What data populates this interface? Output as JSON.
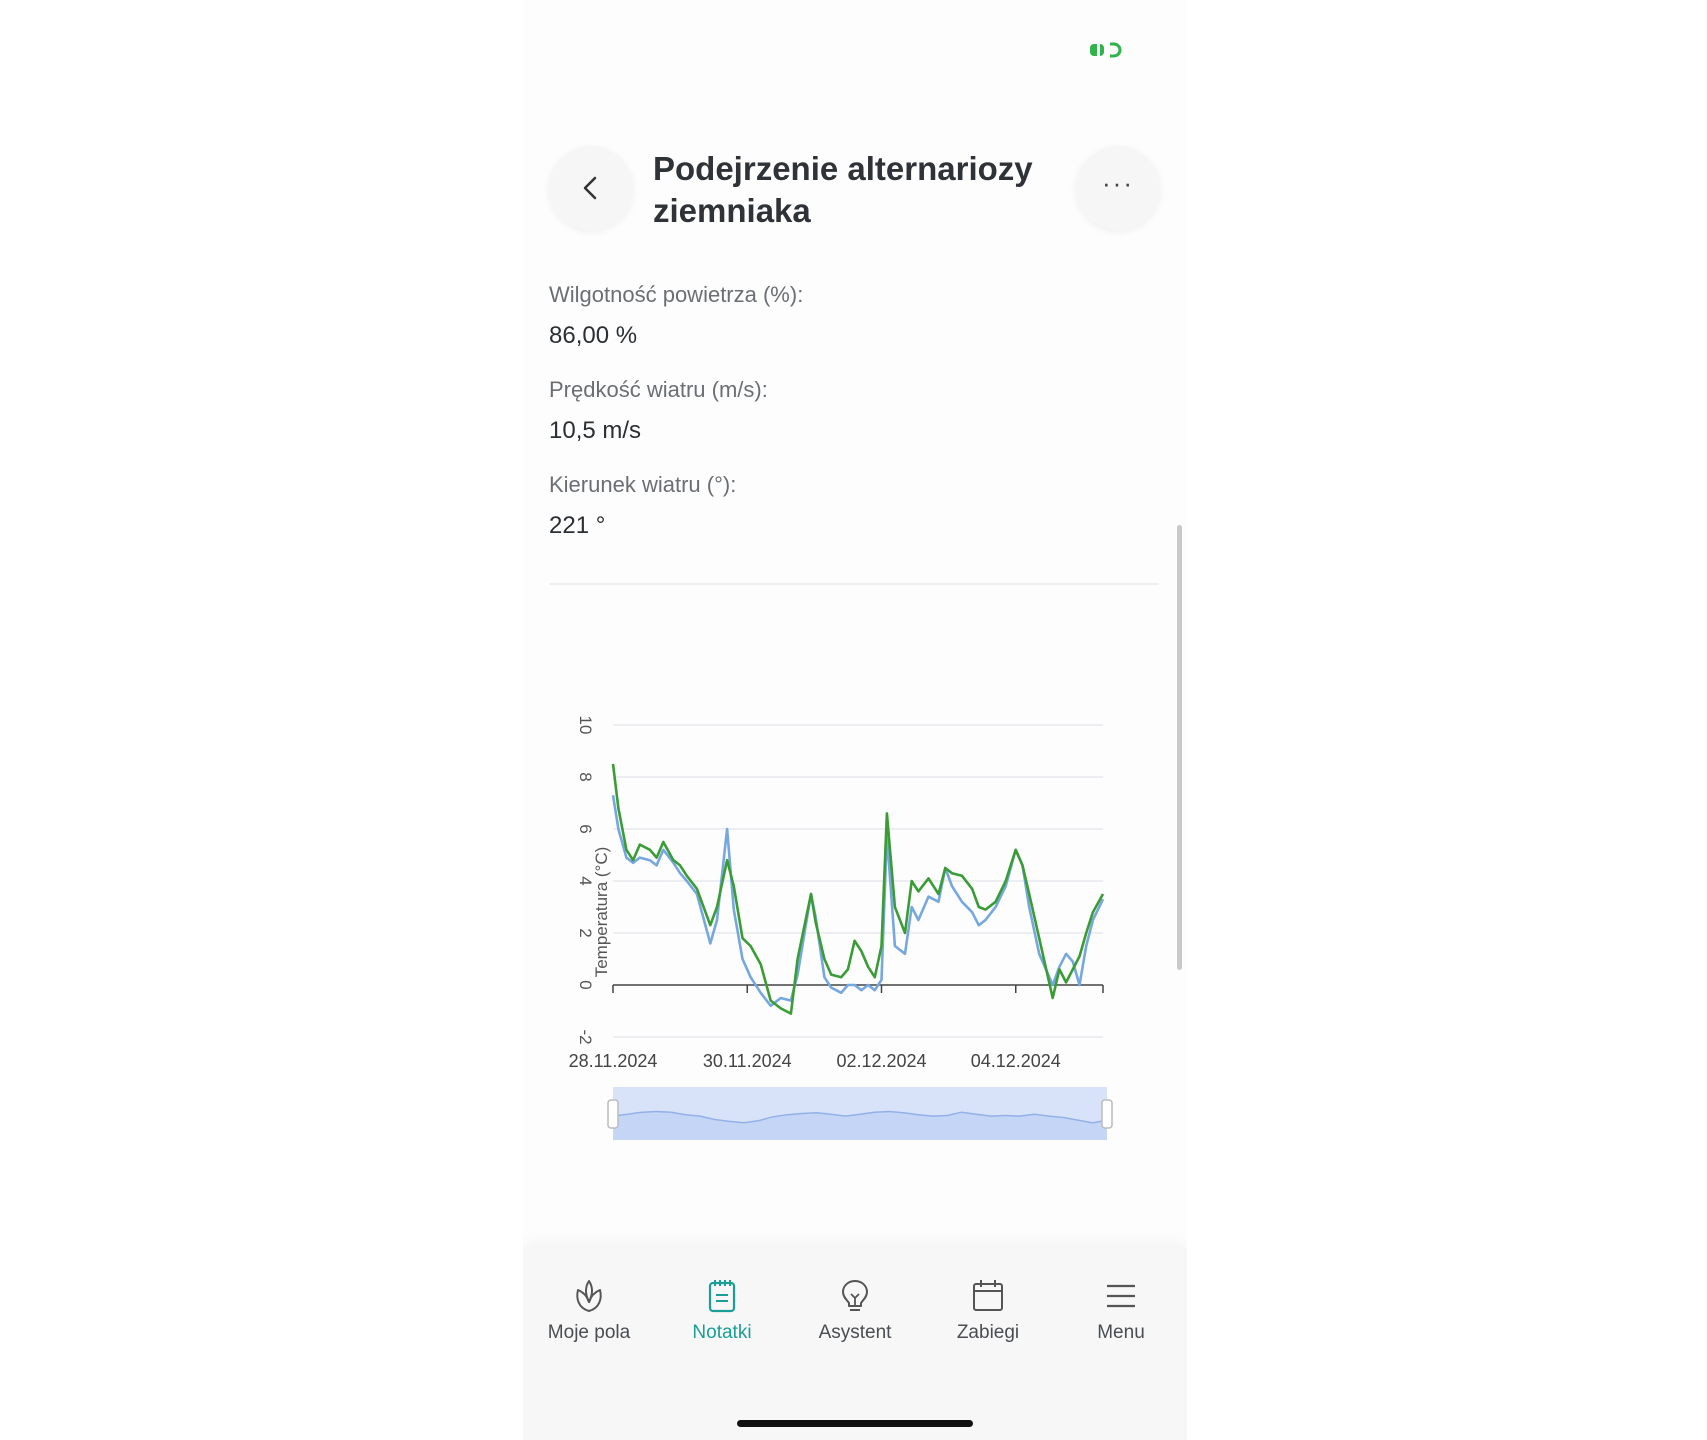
{
  "header": {
    "title": "Podejrzenie alternariozy ziemniaka",
    "back_icon": "chevron-left-icon",
    "more_icon": "more-horizontal-icon",
    "more_label": "···"
  },
  "status": {
    "indicator_icon": "battery-status-icon",
    "indicator_color": "#2fb34a"
  },
  "details": [
    {
      "label": "Wilgotność powietrza (%):",
      "value": "86,00 %"
    },
    {
      "label": "Prędkość wiatru (m/s):",
      "value": "10,5 m/s"
    },
    {
      "label": "Kierunek wiatru (°):",
      "value": "221 °"
    }
  ],
  "chart_data": {
    "type": "line",
    "title": "",
    "xlabel": "",
    "ylabel": "Temperatura (°C)",
    "xlim": [
      0,
      7.3
    ],
    "ylim": [
      -2,
      10
    ],
    "yticks": [
      -2,
      0,
      2,
      4,
      6,
      8,
      10
    ],
    "xtick_labels": [
      "28.11.2024",
      "30.11.2024",
      "02.12.2024",
      "04.12.2024"
    ],
    "xtick_positions": [
      0,
      2,
      4,
      6
    ],
    "grid": true,
    "legend": "none",
    "series": [
      {
        "color": "#3a9c35",
        "x": [
          0,
          0.08,
          0.2,
          0.3,
          0.4,
          0.55,
          0.65,
          0.75,
          0.9,
          1.0,
          1.1,
          1.25,
          1.45,
          1.55,
          1.7,
          1.8,
          1.93,
          2.05,
          2.2,
          2.35,
          2.5,
          2.65,
          2.75,
          2.95,
          3.02,
          3.15,
          3.25,
          3.4,
          3.5,
          3.6,
          3.7,
          3.8,
          3.9,
          4.0,
          4.08,
          4.2,
          4.35,
          4.45,
          4.55,
          4.7,
          4.85,
          4.95,
          5.05,
          5.2,
          5.35,
          5.45,
          5.55,
          5.7,
          5.85,
          6.0,
          6.1,
          6.2,
          6.35,
          6.55,
          6.65,
          6.75,
          6.85,
          6.95,
          7.05,
          7.15,
          7.3
        ],
        "y": [
          8.5,
          6.8,
          5.2,
          4.8,
          5.4,
          5.2,
          4.9,
          5.5,
          4.8,
          4.6,
          4.2,
          3.7,
          2.3,
          3.0,
          4.8,
          3.8,
          1.8,
          1.5,
          0.8,
          -0.6,
          -0.9,
          -1.1,
          1.0,
          3.5,
          2.4,
          1.0,
          0.4,
          0.3,
          0.6,
          1.7,
          1.3,
          0.7,
          0.3,
          1.5,
          6.6,
          3.0,
          2.0,
          4.0,
          3.6,
          4.1,
          3.5,
          4.5,
          4.3,
          4.2,
          3.7,
          3.0,
          2.9,
          3.2,
          4.0,
          5.2,
          4.6,
          3.5,
          1.8,
          -0.5,
          0.6,
          0.1,
          0.6,
          1.1,
          2.0,
          2.8,
          3.5
        ]
      },
      {
        "color": "#76a7df",
        "x": [
          0,
          0.08,
          0.2,
          0.3,
          0.4,
          0.55,
          0.65,
          0.75,
          0.9,
          1.0,
          1.1,
          1.25,
          1.45,
          1.55,
          1.7,
          1.8,
          1.93,
          2.05,
          2.2,
          2.35,
          2.5,
          2.65,
          2.75,
          2.95,
          3.02,
          3.15,
          3.25,
          3.4,
          3.5,
          3.6,
          3.7,
          3.8,
          3.9,
          4.0,
          4.08,
          4.2,
          4.35,
          4.45,
          4.55,
          4.7,
          4.85,
          4.95,
          5.05,
          5.2,
          5.35,
          5.45,
          5.55,
          5.7,
          5.85,
          6.0,
          6.1,
          6.2,
          6.35,
          6.55,
          6.65,
          6.75,
          6.85,
          6.95,
          7.05,
          7.15,
          7.3
        ],
        "y": [
          7.3,
          6.0,
          4.9,
          4.7,
          4.9,
          4.8,
          4.6,
          5.2,
          4.7,
          4.3,
          4.0,
          3.5,
          1.6,
          2.5,
          6.0,
          2.9,
          1.0,
          0.3,
          -0.3,
          -0.8,
          -0.5,
          -0.6,
          0.4,
          3.5,
          2.6,
          0.3,
          -0.1,
          -0.3,
          0.0,
          0.0,
          -0.2,
          0.0,
          -0.2,
          0.2,
          5.8,
          1.5,
          1.2,
          3.0,
          2.5,
          3.4,
          3.2,
          4.5,
          3.8,
          3.2,
          2.8,
          2.3,
          2.5,
          3.0,
          3.8,
          5.2,
          4.6,
          3.0,
          1.2,
          0.0,
          0.7,
          1.2,
          0.9,
          0.0,
          1.5,
          2.5,
          3.3
        ]
      }
    ],
    "navigator_values": [
      3.6,
      3.9,
      4.2,
      4.3,
      4.2,
      3.8,
      3.6,
      3.1,
      2.8,
      2.6,
      2.9,
      3.5,
      3.8,
      4.0,
      4.1,
      3.9,
      3.6,
      3.9,
      4.2,
      4.3,
      4.1,
      3.8,
      3.6,
      3.7,
      4.2,
      3.9,
      3.6,
      3.7,
      3.6,
      3.9,
      3.6,
      3.4,
      3.0,
      2.6,
      3.0
    ]
  },
  "navigator": {
    "fill": "#d8e3fa",
    "line": "#93b1e8"
  },
  "nav": {
    "items": [
      {
        "label": "Moje pola",
        "icon": "plant-icon",
        "active": false
      },
      {
        "label": "Notatki",
        "icon": "notepad-icon",
        "active": true
      },
      {
        "label": "Asystent",
        "icon": "lightbulb-icon",
        "active": false
      },
      {
        "label": "Zabiegi",
        "icon": "calendar-icon",
        "active": false
      },
      {
        "label": "Menu",
        "icon": "hamburger-menu-icon",
        "active": false
      }
    ],
    "active_color": "#1a9e95"
  }
}
